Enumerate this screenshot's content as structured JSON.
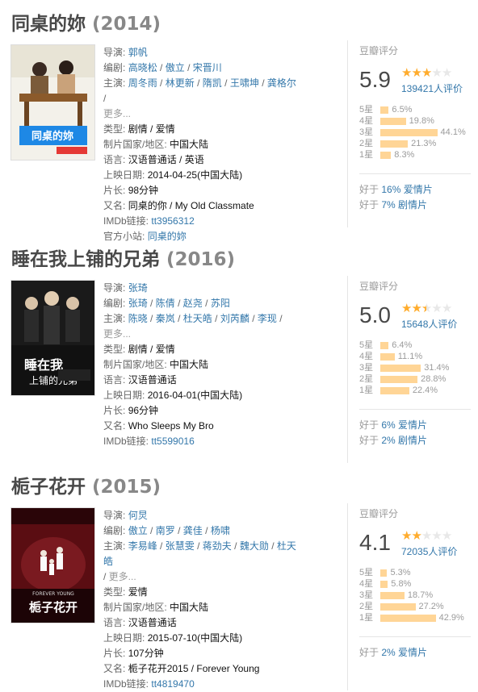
{
  "movies": [
    {
      "title": "同桌的妳",
      "year": "(2014)",
      "director_label": "导演:",
      "director": "郭帆",
      "writers_label": "编剧:",
      "writers": [
        "高晓松",
        "傲立",
        "宋晋川"
      ],
      "cast_label": "主演:",
      "cast": [
        "周冬雨",
        "林更新",
        "隋凯",
        "王啸坤",
        "龚格尔"
      ],
      "more": "更多...",
      "genre_label": "类型:",
      "genres": [
        "剧情",
        "爱情"
      ],
      "country_label": "制片国家/地区:",
      "country": "中国大陆",
      "lang_label": "语言:",
      "lang": "汉语普通话 / 英语",
      "release_label": "上映日期:",
      "release": "2014-04-25(中国大陆)",
      "runtime_label": "片长:",
      "runtime": "98分钟",
      "aka_label": "又名:",
      "aka": "同桌的你 / My Old Classmate",
      "imdb_label": "IMDb链接:",
      "imdb": "tt3956312",
      "site_label": "官方小站:",
      "site": "同桌的妳",
      "rating_title": "豆瓣评分",
      "score": "5.9",
      "stars_value": 3,
      "votes": "139421人评价",
      "dist": [
        {
          "label": "5星",
          "pct": "6.5%",
          "value": 6.5
        },
        {
          "label": "4星",
          "pct": "19.8%",
          "value": 19.8
        },
        {
          "label": "3星",
          "pct": "44.1%",
          "value": 44.1
        },
        {
          "label": "2星",
          "pct": "21.3%",
          "value": 21.3
        },
        {
          "label": "1星",
          "pct": "8.3%",
          "value": 8.3
        }
      ],
      "better": [
        {
          "prefix": "好于",
          "text": "16% 爱情片"
        },
        {
          "prefix": "好于",
          "text": "7% 剧情片"
        }
      ]
    },
    {
      "title": "睡在我上铺的兄弟",
      "year": "(2016)",
      "director_label": "导演:",
      "director": "张琦",
      "writers_label": "编剧:",
      "writers": [
        "张琦",
        "陈倩",
        "赵尧",
        "苏阳"
      ],
      "cast_label": "主演:",
      "cast": [
        "陈晓",
        "秦岚",
        "杜天皓",
        "刘芮麟",
        "李现"
      ],
      "more": "更多...",
      "genre_label": "类型:",
      "genres": [
        "剧情",
        "爱情"
      ],
      "country_label": "制片国家/地区:",
      "country": "中国大陆",
      "lang_label": "语言:",
      "lang": "汉语普通话",
      "release_label": "上映日期:",
      "release": "2016-04-01(中国大陆)",
      "runtime_label": "片长:",
      "runtime": "96分钟",
      "aka_label": "又名:",
      "aka": "Who Sleeps My Bro",
      "imdb_label": "IMDb链接:",
      "imdb": "tt5599016",
      "rating_title": "豆瓣评分",
      "score": "5.0",
      "stars_value": 2.5,
      "votes": "15648人评价",
      "dist": [
        {
          "label": "5星",
          "pct": "6.4%",
          "value": 6.4
        },
        {
          "label": "4星",
          "pct": "11.1%",
          "value": 11.1
        },
        {
          "label": "3星",
          "pct": "31.4%",
          "value": 31.4
        },
        {
          "label": "2星",
          "pct": "28.8%",
          "value": 28.8
        },
        {
          "label": "1星",
          "pct": "22.4%",
          "value": 22.4
        }
      ],
      "better": [
        {
          "prefix": "好于",
          "text": "6% 爱情片"
        },
        {
          "prefix": "好于",
          "text": "2% 剧情片"
        }
      ]
    },
    {
      "title": "栀子花开",
      "year": "(2015)",
      "director_label": "导演:",
      "director": "何炅",
      "writers_label": "编剧:",
      "writers": [
        "傲立",
        "南罗",
        "龚佳",
        "杨啸"
      ],
      "cast_label": "主演:",
      "cast": [
        "李易峰",
        "张慧雯",
        "蒋劲夫",
        "魏大勋",
        "杜天皓"
      ],
      "more": "更多...",
      "genre_label": "类型:",
      "genres": [
        "爱情"
      ],
      "country_label": "制片国家/地区:",
      "country": "中国大陆",
      "lang_label": "语言:",
      "lang": "汉语普通话",
      "release_label": "上映日期:",
      "release": "2015-07-10(中国大陆)",
      "runtime_label": "片长:",
      "runtime": "107分钟",
      "aka_label": "又名:",
      "aka": "栀子花开2015 / Forever Young",
      "imdb_label": "IMDb链接:",
      "imdb": "tt4819470",
      "rating_title": "豆瓣评分",
      "score": "4.1",
      "stars_value": 2,
      "votes": "72035人评价",
      "dist": [
        {
          "label": "5星",
          "pct": "5.3%",
          "value": 5.3
        },
        {
          "label": "4星",
          "pct": "5.8%",
          "value": 5.8
        },
        {
          "label": "3星",
          "pct": "18.7%",
          "value": 18.7
        },
        {
          "label": "2星",
          "pct": "27.2%",
          "value": 27.2
        },
        {
          "label": "1星",
          "pct": "42.9%",
          "value": 42.9
        }
      ],
      "better": [
        {
          "prefix": "好于",
          "text": "2% 爱情片"
        }
      ]
    }
  ]
}
